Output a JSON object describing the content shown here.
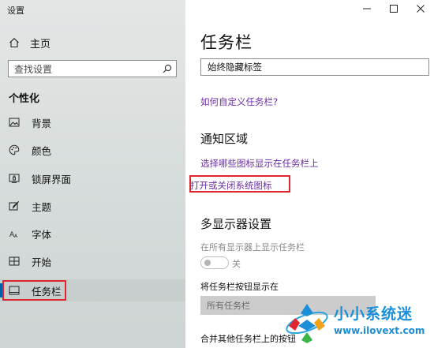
{
  "window": {
    "title": "设置"
  },
  "sidebar": {
    "home_label": "主页",
    "search_placeholder": "查找设置",
    "section_title": "个性化",
    "items": [
      {
        "label": "背景",
        "icon": "image-icon"
      },
      {
        "label": "颜色",
        "icon": "palette-icon"
      },
      {
        "label": "锁屏界面",
        "icon": "lock-screen-icon"
      },
      {
        "label": "主题",
        "icon": "theme-brush-icon"
      },
      {
        "label": "字体",
        "icon": "font-icon"
      },
      {
        "label": "开始",
        "icon": "start-grid-icon"
      },
      {
        "label": "任务栏",
        "icon": "taskbar-icon",
        "selected": true
      }
    ]
  },
  "main": {
    "title": "任务栏",
    "combine_dropdown_value": "始终隐藏标签",
    "customize_link": "如何自定义任务栏?",
    "notification_heading": "通知区域",
    "select_icons_link": "选择哪些图标显示在任务栏上",
    "system_icons_link": "打开或关闭系统图标",
    "multi_display_heading": "多显示器设置",
    "show_all_displays_label": "在所有显示器上显示任务栏",
    "toggle_state": "关",
    "show_buttons_label": "将任务栏按钮显示在",
    "buttons_dropdown_value": "所有任务栏",
    "combine_other_label": "合并其他任务栏上的按钮"
  },
  "watermark": {
    "name": "小小系统迷",
    "url": "www.ilovext.com"
  },
  "colors": {
    "accent": "#0063b1",
    "link": "#6b2fa3",
    "highlight": "#e0262f",
    "watermark": "#1a8fd8"
  }
}
